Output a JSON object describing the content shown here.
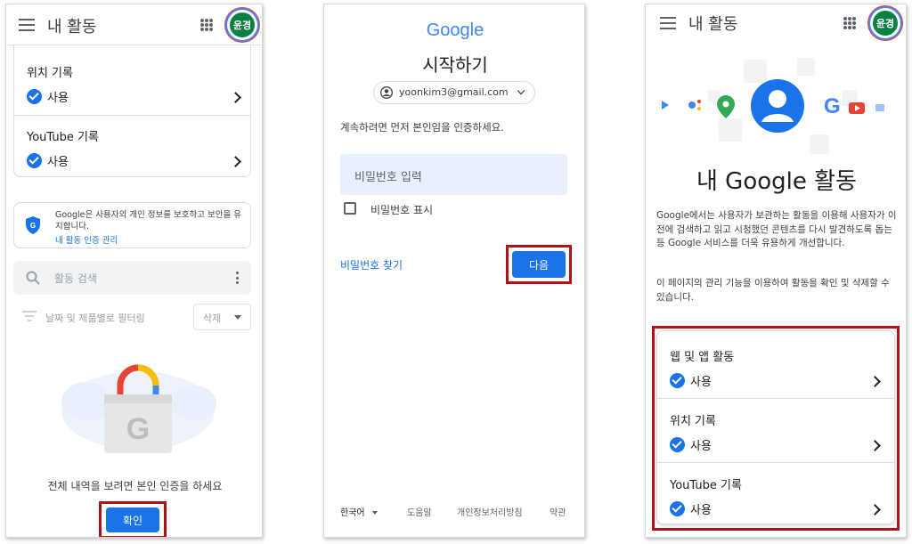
{
  "panel1": {
    "title": "내 활동",
    "avatar_text": "윤경",
    "rows": [
      {
        "title": "위치 기록",
        "status": "사용"
      },
      {
        "title": "YouTube 기록",
        "status": "사용"
      }
    ],
    "protect_text": "Google은 사용자의 개인 정보를 보호하고 보안을 유지합니다.",
    "protect_link": "내 활동 인증 관리",
    "search_placeholder": "활동 검색",
    "filter_label": "날짜 및 제품별로 필터링",
    "delete_label": "삭제",
    "verify_text": "전체 내역을 보려면 본인 인증을 하세요",
    "confirm_label": "확인"
  },
  "panel2": {
    "logo": "Google",
    "heading": "시작하기",
    "account_email": "yoonkim3@gmail.com",
    "instruction": "계속하려면 먼저 본인임을 인증하세요.",
    "password_placeholder": "비밀번호 입력",
    "show_password": "비밀번호 표시",
    "forgot_password": "비밀번호 찾기",
    "next_label": "다음",
    "footer": {
      "language": "한국어",
      "help": "도움말",
      "privacy": "개인정보처리방침",
      "terms": "약관"
    }
  },
  "panel3": {
    "title": "내 활동",
    "avatar_text": "윤경",
    "hero_title": "내 Google 활동",
    "desc1": "Google에서는 사용자가 보관하는 활동을 이용해 사용자가 이전에 검색하고 읽고 시청했던 콘텐츠를 다시 발견하도록 돕는 등 Google 서비스를 더욱 유용하게 개선합니다.",
    "desc2": "이 페이지의 관리 기능을 이용하여 활동을 확인 및 삭제할 수 있습니다.",
    "rows": [
      {
        "title": "웹 및 앱 활동",
        "status": "사용"
      },
      {
        "title": "위치 기록",
        "status": "사용"
      },
      {
        "title": "YouTube 기록",
        "status": "사용"
      }
    ]
  },
  "colors": {
    "accent": "#1a73e8",
    "highlight": "#b3111a",
    "avatar": "#0b8043"
  }
}
